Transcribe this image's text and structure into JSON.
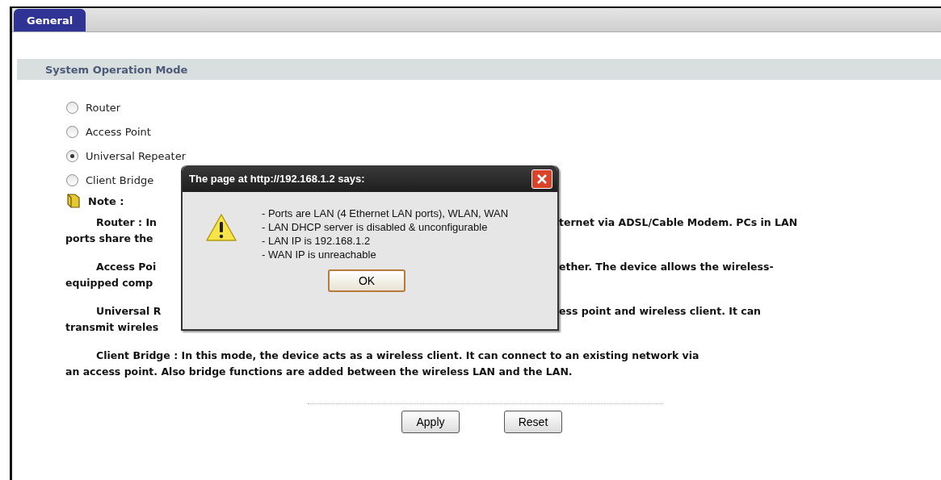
{
  "tabs": [
    {
      "label": "General",
      "selected": true
    }
  ],
  "section": {
    "title": "System Operation Mode"
  },
  "modes": [
    {
      "label": "Router",
      "selected": false
    },
    {
      "label": "Access Point",
      "selected": false
    },
    {
      "label": "Universal Repeater",
      "selected": true
    },
    {
      "label": "Client Bridge",
      "selected": false
    }
  ],
  "note": {
    "title": "Note :",
    "paragraphs": [
      {
        "lines": [
          {
            "left": "Router : In",
            "right": "ternet via ADSL/Cable Modem. PCs in LAN"
          },
          {
            "left": "ports share the"
          }
        ]
      },
      {
        "lines": [
          {
            "left": "Access Poi",
            "right": "ether. The device allows the wireless-"
          },
          {
            "left": "equipped comp"
          }
        ]
      },
      {
        "lines": [
          {
            "left": "Universal R",
            "right": "ess point and wireless client. It can"
          },
          {
            "left": "transmit wireles"
          }
        ]
      },
      {
        "lines": [
          {
            "left": "Client Bridge : In this mode, the device acts as a wireless client. It can connect to an existing network via"
          },
          {
            "left": "an access point. Also bridge functions are added between the wireless LAN and the LAN."
          }
        ]
      }
    ]
  },
  "buttons": [
    "Apply",
    "Reset"
  ],
  "dialog": {
    "title": "The page at http://192.168.1.2 says:",
    "lines": [
      "- Ports are LAN (4 Ethernet LAN ports), WLAN, WAN",
      "- LAN DHCP server is disabled & unconfigurable",
      "- LAN IP is 192.168.1.2",
      "- WAN IP is unreachable"
    ],
    "button": "OK"
  }
}
